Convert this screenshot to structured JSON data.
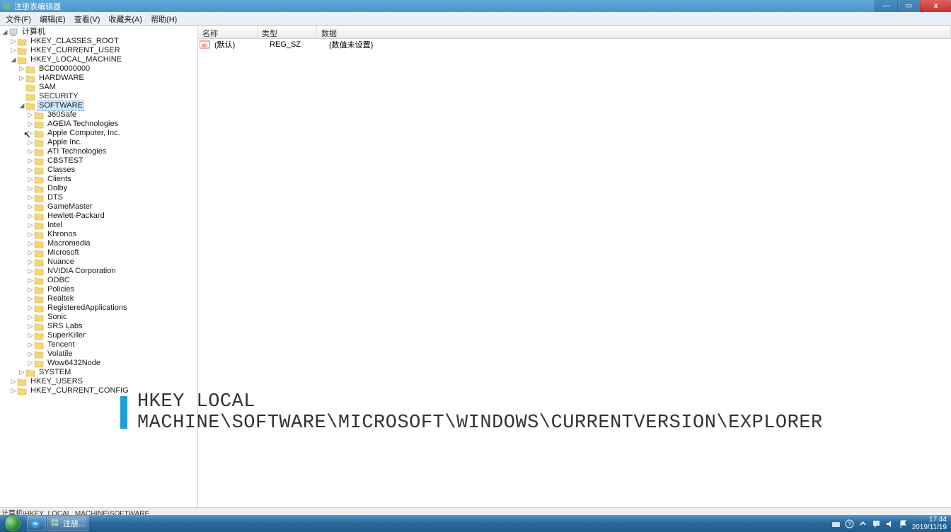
{
  "window": {
    "title": "注册表编辑器"
  },
  "menu": {
    "file": "文件(F)",
    "edit": "编辑(E)",
    "view": "查看(V)",
    "favorites": "收藏夹(A)",
    "help": "帮助(H)"
  },
  "tree": {
    "root": "计算机",
    "hives": {
      "classes_root": "HKEY_CLASSES_ROOT",
      "current_user": "HKEY_CURRENT_USER",
      "local_machine": "HKEY_LOCAL_MACHINE",
      "users": "HKEY_USERS",
      "current_config": "HKEY_CURRENT_CONFIG"
    },
    "hklm_children": [
      "BCD00000000",
      "HARDWARE",
      "SAM",
      "SECURITY",
      "SOFTWARE",
      "SYSTEM"
    ],
    "software_children": [
      "360Safe",
      "AGEIA Technologies",
      "Apple Computer, Inc.",
      "Apple Inc.",
      "ATI Technologies",
      "CBSTEST",
      "Classes",
      "Clients",
      "Dolby",
      "DTS",
      "GameMaster",
      "Hewlett-Packard",
      "Intel",
      "Khronos",
      "Macromedia",
      "Microsoft",
      "Nuance",
      "NVIDIA Corporation",
      "ODBC",
      "Policies",
      "Realtek",
      "RegisteredApplications",
      "Sonic",
      "SRS Labs",
      "SuperKiller",
      "Tencent",
      "Volatile",
      "Wow6432Node"
    ]
  },
  "list": {
    "columns": {
      "name": "名称",
      "type": "类型",
      "data": "数据"
    },
    "rows": [
      {
        "name": "(默认)",
        "type": "REG_SZ",
        "data": "(数值未设置)"
      }
    ]
  },
  "statusbar": "计算机\\HKEY_LOCAL_MACHINE\\SOFTWARE",
  "overlay": "HKEY LOCAL MACHINE\\SOFTWARE\\MICROSOFT\\WINDOWS\\CURRENTVERSION\\EXPLORER",
  "taskbar": {
    "items": [
      {
        "label": "注册..."
      }
    ],
    "time": "17:44",
    "date": "2019/11/19"
  }
}
